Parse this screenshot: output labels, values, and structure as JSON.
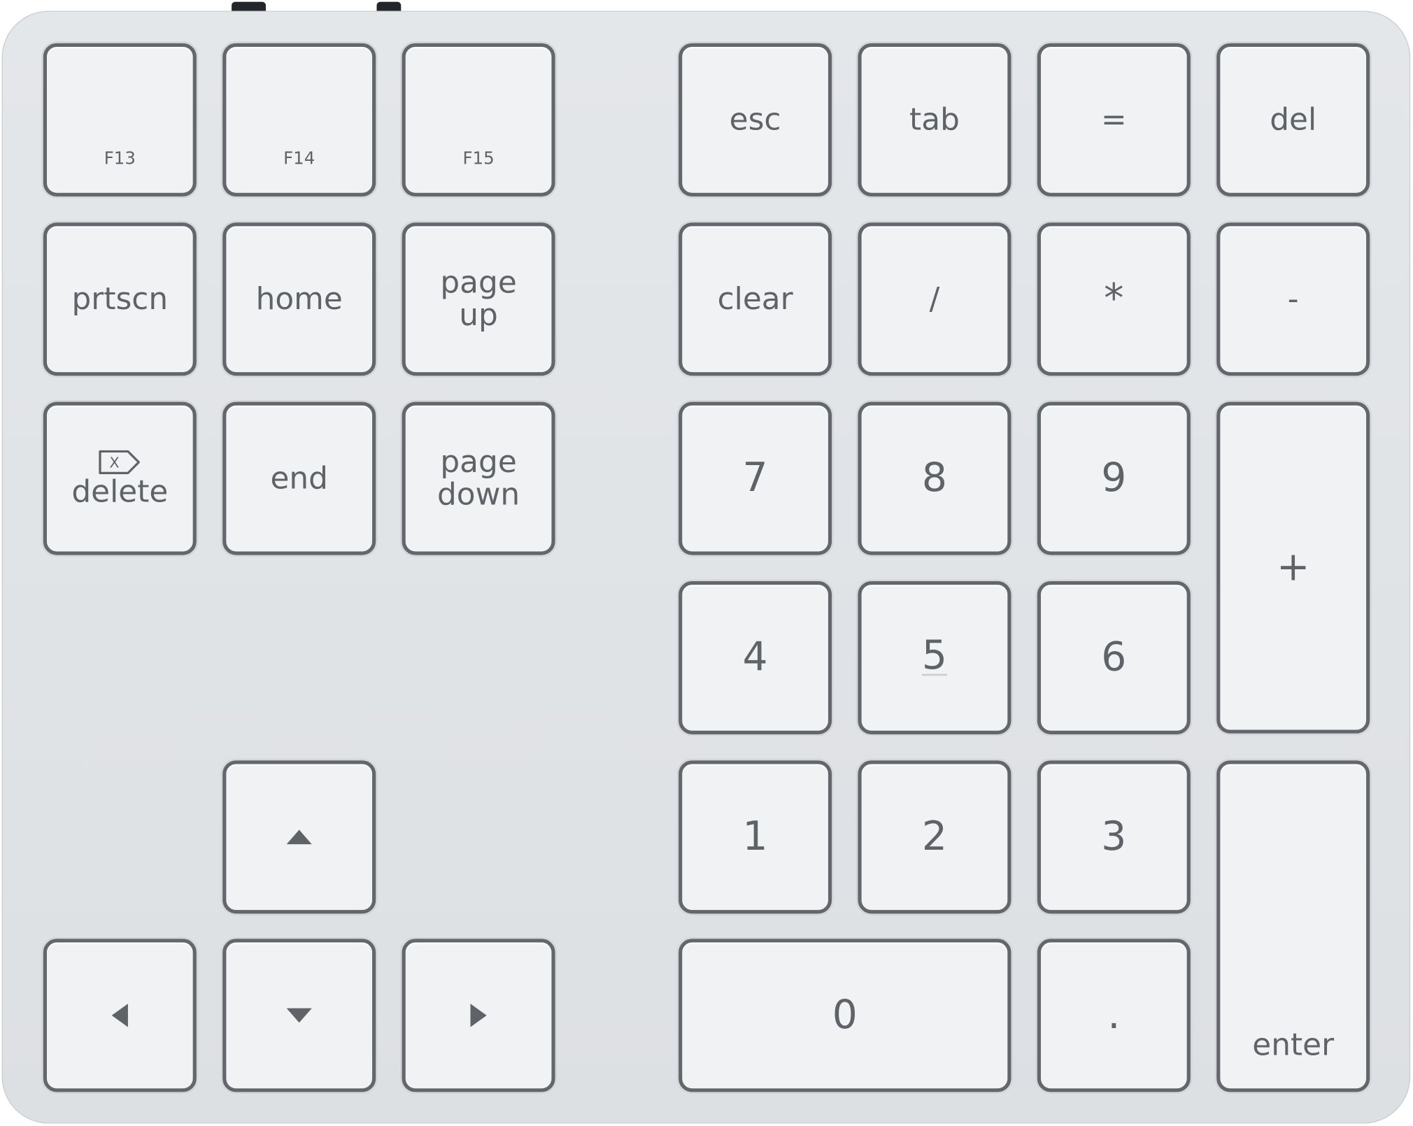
{
  "keyboard": {
    "colors": {
      "body": "#e0e3e6",
      "key": "#f1f2f4",
      "key_border": "#63676b",
      "legend": "#5f6367"
    },
    "keys": {
      "f13": "F13",
      "f14": "F14",
      "f15": "F15",
      "esc": "esc",
      "tab": "tab",
      "equals": "=",
      "del": "del",
      "prtscn": "prtscn",
      "home": "home",
      "page_up_1": "page",
      "page_up_2": "up",
      "clear": "clear",
      "slash": "/",
      "asterisk": "*",
      "minus": "-",
      "delete": "delete",
      "delete_icon": "X",
      "end": "end",
      "page_down_1": "page",
      "page_down_2": "down",
      "seven": "7",
      "eight": "8",
      "nine": "9",
      "plus": "+",
      "four": "4",
      "five": "5",
      "six": "6",
      "one": "1",
      "two": "2",
      "three": "3",
      "enter": "enter",
      "zero": "0",
      "dot": "."
    },
    "icons": {
      "up": "arrow-up-icon",
      "left": "arrow-left-icon",
      "down": "arrow-down-icon",
      "right": "arrow-right-icon",
      "delete": "delete-backspace-icon"
    }
  }
}
